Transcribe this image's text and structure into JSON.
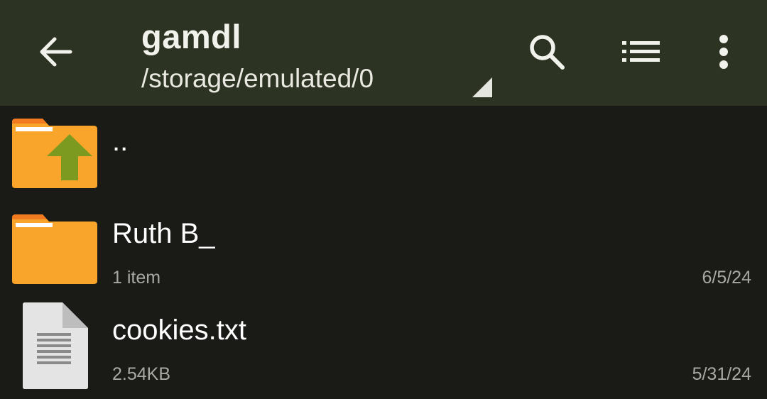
{
  "toolbar": {
    "title": "gamdl",
    "path": "/storage/emulated/0",
    "back_icon": "arrow-left-icon",
    "search_icon": "search-icon",
    "view_icon": "list-view-icon",
    "more_icon": "more-vert-icon",
    "background_color": "#2d3322"
  },
  "files": [
    {
      "name": "..",
      "icon": "folder-up-icon",
      "meta": "",
      "date": ""
    },
    {
      "name": "Ruth B_",
      "icon": "folder-icon",
      "meta": "1 item",
      "date": "6/5/24"
    },
    {
      "name": "cookies.txt",
      "icon": "text-file-icon",
      "meta": "2.54KB",
      "date": "5/31/24"
    }
  ],
  "colors": {
    "folder": "#f9a52b",
    "folder_tab": "#f27a21",
    "up_arrow": "#7c9a1f",
    "list_background": "#1a1a17"
  }
}
